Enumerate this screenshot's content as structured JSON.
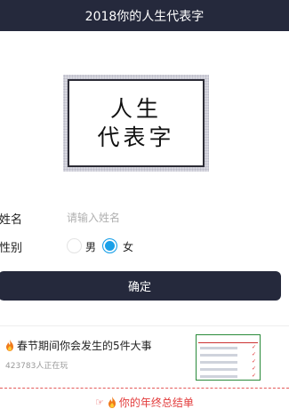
{
  "header": {
    "title": "2018你的人生代表字"
  },
  "banner": {
    "line1": "人生",
    "line2": "代表字"
  },
  "form": {
    "name_label": "姓名",
    "name_placeholder": "请输入姓名",
    "name_value": "",
    "gender_label": "性别",
    "gender_options": [
      "男",
      "女"
    ],
    "gender_selected": "女",
    "confirm_label": "确定"
  },
  "promo": {
    "title": "春节期间你会发生的5件大事",
    "subtitle": "423783人正在玩",
    "thumbnail_icon": "checklist-thumbnail"
  },
  "footer_link": {
    "label": "你的年终总结单"
  },
  "colors": {
    "header_bg": "#25293c",
    "radio_selected": "#1aa0e8",
    "link_red": "#e23b3b"
  }
}
